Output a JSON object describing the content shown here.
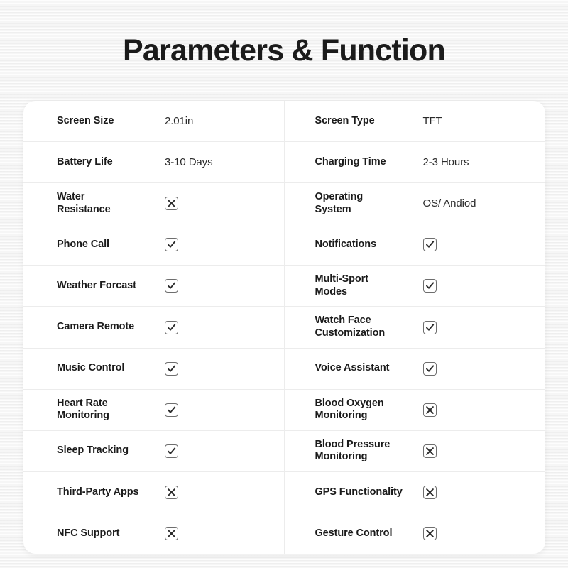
{
  "page": {
    "title": "Parameters & Function",
    "background_color": "#f2f2f2",
    "card_color": "#ffffff",
    "text_color": "#1b1b1b",
    "divider_color": "#ececec",
    "checkbox_border_color": "#6e6e6e"
  },
  "spec_table": {
    "rows": [
      {
        "left": {
          "label": "Screen Size",
          "value": "2.01in",
          "type": "text"
        },
        "right": {
          "label": "Screen Type",
          "value": "TFT",
          "type": "text"
        }
      },
      {
        "left": {
          "label": "Battery Life",
          "value": "3-10 Days",
          "type": "text"
        },
        "right": {
          "label": "Charging Time",
          "value": "2-3 Hours",
          "type": "text"
        }
      },
      {
        "left": {
          "label": "Water\nResistance",
          "value": "unchecked",
          "type": "checkbox"
        },
        "right": {
          "label": "Operating\nSystem",
          "value": "OS/ Andiod",
          "type": "text"
        }
      },
      {
        "left": {
          "label": "Phone Call",
          "value": "checked",
          "type": "checkbox"
        },
        "right": {
          "label": "Notifications",
          "value": "checked",
          "type": "checkbox"
        }
      },
      {
        "left": {
          "label": "Weather Forcast",
          "value": "checked",
          "type": "checkbox"
        },
        "right": {
          "label": "Multi-Sport\nModes",
          "value": "checked",
          "type": "checkbox"
        }
      },
      {
        "left": {
          "label": "Camera Remote",
          "value": "checked",
          "type": "checkbox"
        },
        "right": {
          "label": "Watch Face\nCustomization",
          "value": "checked",
          "type": "checkbox"
        }
      },
      {
        "left": {
          "label": "Music Control",
          "value": "checked",
          "type": "checkbox"
        },
        "right": {
          "label": "Voice Assistant",
          "value": "checked",
          "type": "checkbox"
        }
      },
      {
        "left": {
          "label": "Heart Rate\nMonitoring",
          "value": "checked",
          "type": "checkbox"
        },
        "right": {
          "label": "Blood Oxygen\nMonitoring",
          "value": "unchecked",
          "type": "checkbox"
        }
      },
      {
        "left": {
          "label": "Sleep Tracking",
          "value": "checked",
          "type": "checkbox"
        },
        "right": {
          "label": "Blood Pressure\nMonitoring",
          "value": "unchecked",
          "type": "checkbox"
        }
      },
      {
        "left": {
          "label": "Third-Party Apps",
          "value": "unchecked",
          "type": "checkbox"
        },
        "right": {
          "label": "GPS Functionality",
          "value": "unchecked",
          "type": "checkbox"
        }
      },
      {
        "left": {
          "label": "NFC Support",
          "value": "unchecked",
          "type": "checkbox"
        },
        "right": {
          "label": "Gesture Control",
          "value": "unchecked",
          "type": "checkbox"
        }
      }
    ]
  }
}
